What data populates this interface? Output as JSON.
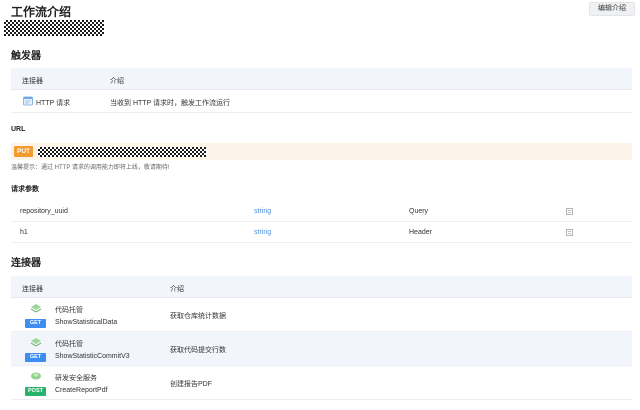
{
  "page": {
    "title": "工作流介绍",
    "edit_button": "编辑介绍"
  },
  "trigger_section": {
    "heading": "触发器",
    "columns": [
      "连接器",
      "介绍"
    ],
    "rows": [
      {
        "name": "HTTP 请求",
        "description": "当收到 HTTP 请求时，触发工作流运行",
        "icon": "http-request-icon"
      }
    ]
  },
  "url_section": {
    "heading": "URL",
    "method": "PUT",
    "hint": "温馨提示：通过 HTTP 请求的调用能力即将上线，敬请期待!"
  },
  "params_section": {
    "heading": "请求参数",
    "rows": [
      {
        "name": "repository_uuid",
        "type": "string",
        "location": "Query",
        "icon": "document-icon"
      },
      {
        "name": "h1",
        "type": "string",
        "location": "Header",
        "icon": "document-icon"
      }
    ]
  },
  "connector_section": {
    "heading": "连接器",
    "columns": [
      "连接器",
      "介绍"
    ],
    "rows": [
      {
        "name": "代码托管",
        "method": "GET",
        "operation": "ShowStatisticalData",
        "description": "获取仓库统计数据",
        "icon": "code-hosting-icon"
      },
      {
        "name": "代码托管",
        "method": "GET",
        "operation": "ShowStatisticCommitV3",
        "description": "获取代码提交行数",
        "icon": "code-hosting-icon"
      },
      {
        "name": "研发安全服务",
        "method": "POST",
        "operation": "CreateReportPdf",
        "description": "创建报告PDF",
        "icon": "security-service-icon"
      }
    ]
  },
  "colors": {
    "method_put": "#f39b2f",
    "method_get": "#3d8ef0",
    "method_post": "#27b36a",
    "type_link": "#4a8fd8"
  }
}
